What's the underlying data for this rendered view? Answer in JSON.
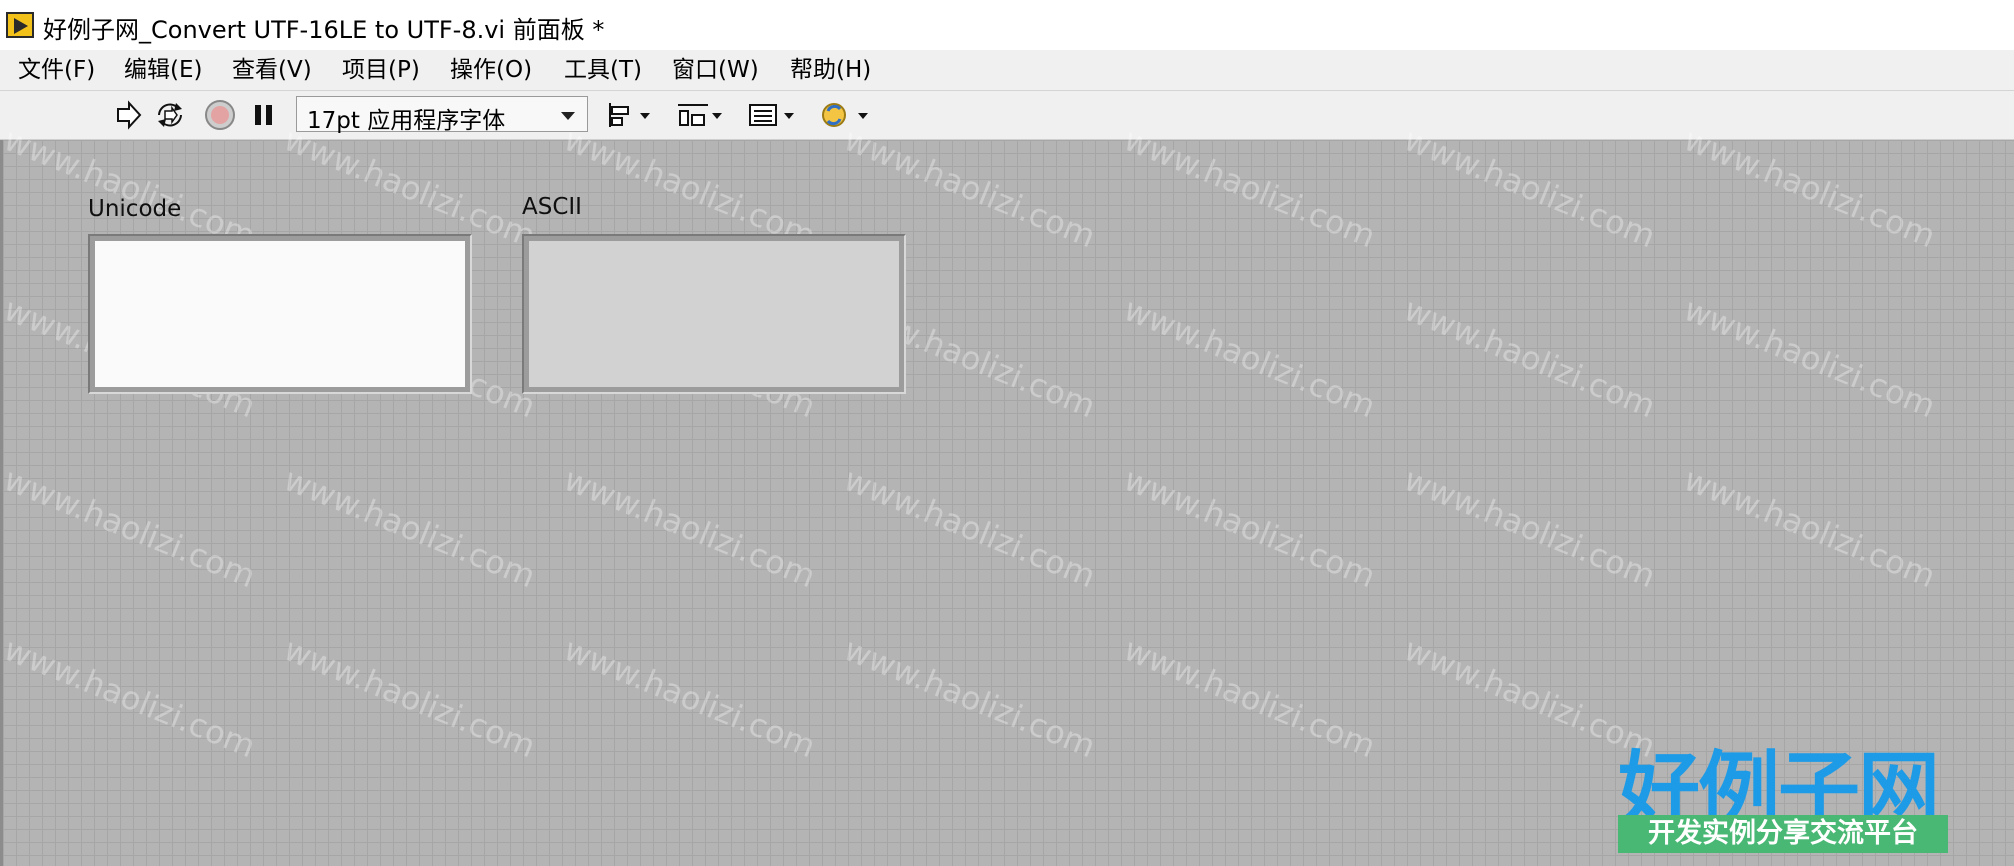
{
  "window": {
    "title": "好例子网_Convert UTF-16LE to UTF-8.vi 前面板 *"
  },
  "menu": {
    "items": [
      {
        "label": "文件(F)"
      },
      {
        "label": "编辑(E)"
      },
      {
        "label": "查看(V)"
      },
      {
        "label": "项目(P)"
      },
      {
        "label": "操作(O)"
      },
      {
        "label": "工具(T)"
      },
      {
        "label": "窗口(W)"
      },
      {
        "label": "帮助(H)"
      }
    ]
  },
  "toolbar": {
    "font_value": "17pt 应用程序字体",
    "icons": [
      "run-arrow-icon",
      "run-continuously-icon",
      "abort-icon",
      "pause-icon",
      "align-objects-icon",
      "distribute-objects-icon",
      "resize-objects-icon",
      "reorder-icon"
    ]
  },
  "controls": {
    "unicode_label": "Unicode",
    "unicode_value": "",
    "ascii_label": "ASCII",
    "ascii_value": ""
  },
  "watermark": {
    "text": "www.haolizi.com",
    "brand_title": "好例子网",
    "brand_subtitle": "开发实例分享交流平台"
  },
  "colors": {
    "panel_bg": "#b4b4b4",
    "unicode_field": "#fafafa",
    "ascii_field": "#d2d2d2",
    "brand_blue": "#1e9be6",
    "brand_green": "#49b874"
  }
}
